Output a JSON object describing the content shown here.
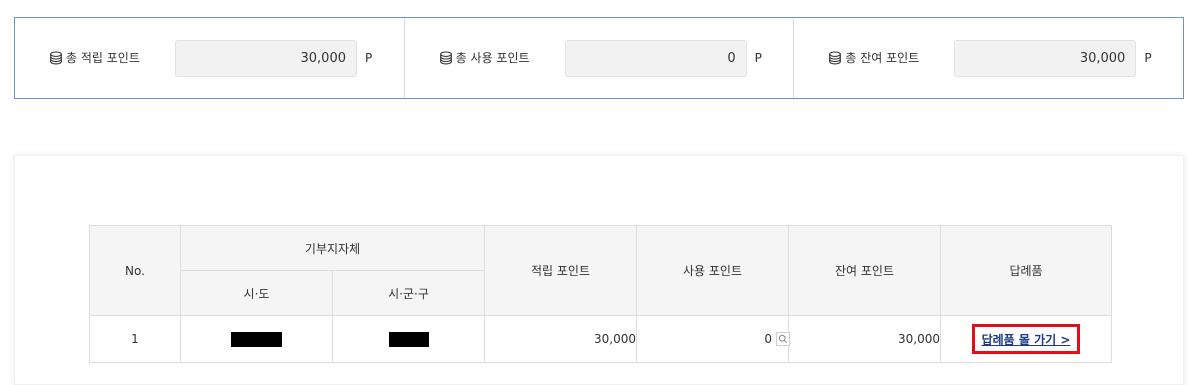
{
  "summary": {
    "items": [
      {
        "label": "총 적립 포인트",
        "value": "30,000",
        "unit": "P"
      },
      {
        "label": "총 사용 포인트",
        "value": "0",
        "unit": "P"
      },
      {
        "label": "총 잔여 포인트",
        "value": "30,000",
        "unit": "P"
      }
    ]
  },
  "table": {
    "headers": {
      "no": "No.",
      "donation_region": "기부지자체",
      "sido": "시·도",
      "sigungu": "시·군·구",
      "earned": "적립 포인트",
      "used": "사용 포인트",
      "remaining": "잔여 포인트",
      "gift": "답례품"
    },
    "rows": [
      {
        "no": "1",
        "earned": "30,000",
        "used": "0",
        "remaining": "30,000",
        "gift_link": "답례품 몰 가기 >"
      }
    ]
  },
  "icons": {
    "summary": "coin-stack-icon",
    "search": "search-icon"
  },
  "colors": {
    "summary_border": "#6f93d0",
    "highlight": "#e0101a",
    "link": "#1d3b86",
    "header_bg": "#f5f5f5"
  }
}
